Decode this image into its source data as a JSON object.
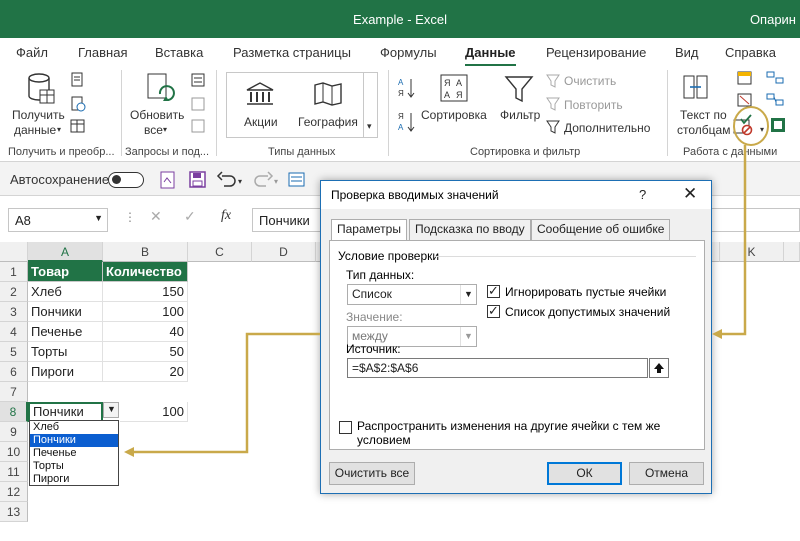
{
  "window": {
    "title": "Example  -  Excel",
    "user": "Опарин"
  },
  "ribbon_tabs": [
    {
      "label": "Файл"
    },
    {
      "label": "Главная"
    },
    {
      "label": "Вставка"
    },
    {
      "label": "Разметка страницы"
    },
    {
      "label": "Формулы"
    },
    {
      "label": "Данные",
      "active": true
    },
    {
      "label": "Рецензирование"
    },
    {
      "label": "Вид"
    },
    {
      "label": "Справка"
    }
  ],
  "ribbon": {
    "get_data": {
      "line1": "Получить",
      "line2": "данные",
      "group": "Получить и преобр..."
    },
    "queries": {
      "line1": "Обновить",
      "line2": "все",
      "group": "Запросы и под..."
    },
    "data_types": {
      "item1": "Акции",
      "item2": "География",
      "group": "Типы данных"
    },
    "sort_filter": {
      "sort": "Сортировка",
      "filter": "Фильтр",
      "clear": "Очистить",
      "reapply": "Повторить",
      "advanced": "Дополнительно",
      "group": "Сортировка и фильтр"
    },
    "data_tools": {
      "line1": "Текст по",
      "line2": "столбцам",
      "group": "Работа с данными"
    }
  },
  "qat": {
    "autosave": "Автосохранение"
  },
  "formula_bar": {
    "name_box": "A8",
    "formula": "Пончики"
  },
  "sheet": {
    "columns": [
      "A",
      "B",
      "C",
      "D",
      "K"
    ],
    "rows": [
      "1",
      "2",
      "3",
      "4",
      "5",
      "6",
      "7",
      "8",
      "9",
      "10",
      "11",
      "12",
      "13"
    ],
    "header": [
      "Товар",
      "Количество"
    ],
    "data": [
      [
        "Хлеб",
        "150"
      ],
      [
        "Пончики",
        "100"
      ],
      [
        "Печенье",
        "40"
      ],
      [
        "Торты",
        "50"
      ],
      [
        "Пироги",
        "20"
      ]
    ],
    "row8": [
      "Пончики",
      "100"
    ],
    "dropdown": [
      "Хлеб",
      "Пончики",
      "Печенье",
      "Торты",
      "Пироги"
    ],
    "dropdown_selected": "Пончики"
  },
  "dialog": {
    "title": "Проверка вводимых значений",
    "help": "?",
    "close": "✕",
    "tabs": [
      "Параметры",
      "Подсказка по вводу",
      "Сообщение об ошибке"
    ],
    "section": "Условие проверки",
    "data_type_label": "Тип данных:",
    "data_type_value": "Список",
    "value_label": "Значение:",
    "value_value": "между",
    "ignore_blank": "Игнорировать пустые ячейки",
    "in_cell_dropdown": "Список допустимых значений",
    "source_label": "Источник:",
    "source_value": "=$A$2:$A$6",
    "apply_all": "Распространить изменения на другие ячейки с тем же условием",
    "clear_all": "Очистить все",
    "ok": "ОК",
    "cancel": "Отмена"
  },
  "colors": {
    "excel_green": "#217346",
    "callout": "#c9a94a",
    "selection": "#0b5ed0"
  },
  "icons": [
    "database-icon",
    "refresh-icon",
    "bank-icon",
    "map-icon",
    "sort-icon",
    "filter-icon",
    "data-validation-icon",
    "undo-icon",
    "redo-icon",
    "save-icon"
  ]
}
